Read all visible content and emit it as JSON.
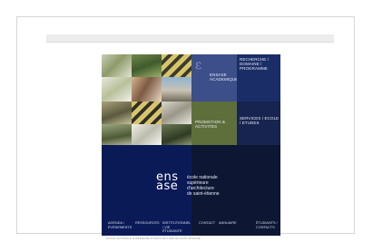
{
  "site": {
    "deco_block": {
      "text": "ENSASE ACADEMIQUE"
    },
    "nav1": {
      "text": "RECHERCHE / DOMAINE / PROGRAMME"
    },
    "green_block": {
      "text": "PROMOTION & ACTIVITES"
    },
    "nav2": {
      "text": "SERVICES / ECOLE / ETUDES"
    },
    "logo": {
      "line1": "ens",
      "line2": "ase"
    },
    "tagline": [
      "école nationale",
      "supérieure",
      "d'architecture",
      "de saint-étienne"
    ]
  },
  "footer": {
    "items": [
      {
        "label": "AGENDA / ÉVÉNEMENTS"
      },
      {
        "label": "RESSOURCES"
      },
      {
        "label": "INSTITUTIONNEL / VIE ÉTUDIANTE"
      },
      {
        "label": "CONTACT"
      },
      {
        "label": "ANNUAIRE"
      },
      {
        "label": "ÉTUDIANTS / CONTACTS"
      }
    ]
  },
  "caption": "ÉCOLE NATIONALE SUPÉRIEURE D'ARCHITECTURE DE SAINT-ÉTIENNE"
}
